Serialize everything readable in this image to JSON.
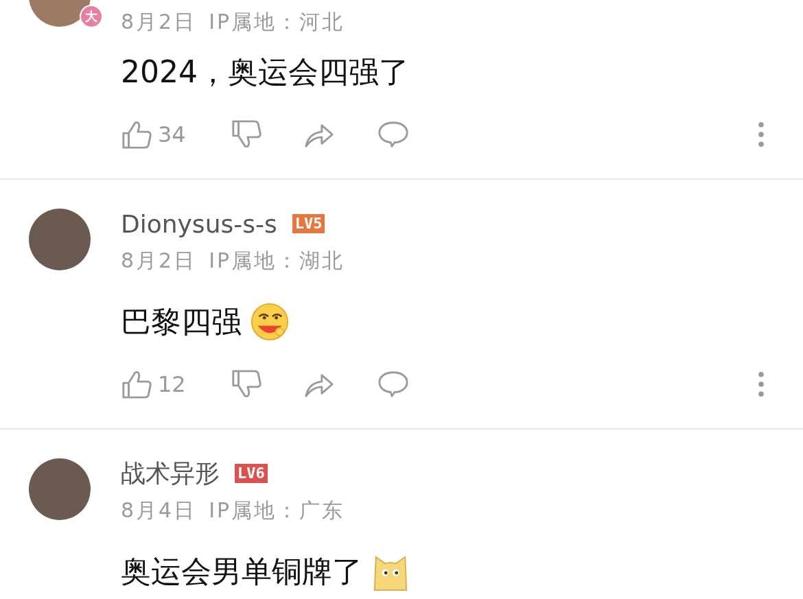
{
  "comments": [
    {
      "avatar_badge": "大",
      "date": "8月2日",
      "ip": "IP属地：河北",
      "body": "2024，奥运会四强了",
      "likes": "34"
    },
    {
      "name": "Dionysus-s-s",
      "level": {
        "label": "LV5",
        "color": "#e5773f"
      },
      "date": "8月2日",
      "ip": "IP属地：湖北",
      "body": "巴黎四强",
      "emoji": {
        "kind": "laughing"
      },
      "likes": "12"
    },
    {
      "name": "战术异形",
      "level": {
        "label": "LV6",
        "color": "#d9524f"
      },
      "date": "8月4日",
      "ip": "IP属地：广东",
      "body": "奥运会男单铜牌了",
      "emoji": {
        "kind": "dog"
      }
    }
  ]
}
